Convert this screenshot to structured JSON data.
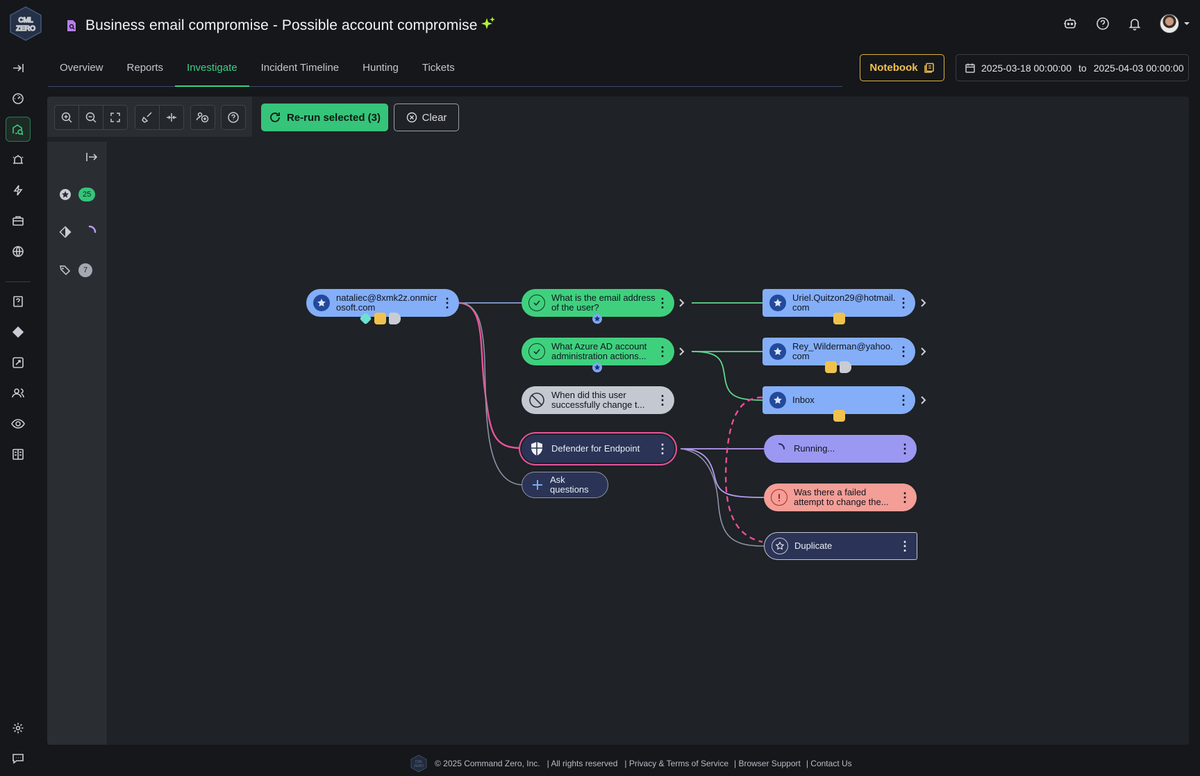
{
  "app": {
    "title": "Business email compromise - Possible account compromise",
    "logo_text": "CMD ZERO"
  },
  "tabs": [
    {
      "label": "Overview"
    },
    {
      "label": "Reports"
    },
    {
      "label": "Investigate"
    },
    {
      "label": "Incident Timeline"
    },
    {
      "label": "Hunting"
    },
    {
      "label": "Tickets"
    }
  ],
  "active_tab": "Investigate",
  "notebook": {
    "label": "Notebook"
  },
  "date_range": {
    "from": "2025-03-18 00:00:00",
    "to_label": "to",
    "to": "2025-04-03 00:00:00"
  },
  "toolbar": {
    "rerun_label": "Re-run selected (3)",
    "clear_label": "Clear"
  },
  "panel": {
    "starred_count": "25",
    "tags_count": "7"
  },
  "nodes": {
    "user": "nataliec@8xmk2z.onmicrosoft.com",
    "q1": "What is the email address of the user?",
    "q2": "What Azure AD account administration actions...",
    "q3": "When did this user successfully change t...",
    "defender": "Defender for Endpoint",
    "ask": "Ask questions",
    "r1": "Uriel.Quitzon29@hotmail.com",
    "r2": "Rey_Wilderman@yahoo.com",
    "r3": "Inbox",
    "running": "Running...",
    "failed": "Was there a failed attempt to change the...",
    "duplicate": "Duplicate"
  },
  "footer": {
    "copyright": "© 2025 Command Zero, Inc.",
    "rights": "| All rights reserved",
    "privacy": "| Privacy & Terms of Service",
    "browser": "| Browser Support",
    "contact": "| Contact Us"
  },
  "colors": {
    "accent_green": "#3ecf86",
    "notebook_gold": "#e0b23a",
    "node_blue": "#84aef8",
    "edge_pink": "#e9539a"
  }
}
